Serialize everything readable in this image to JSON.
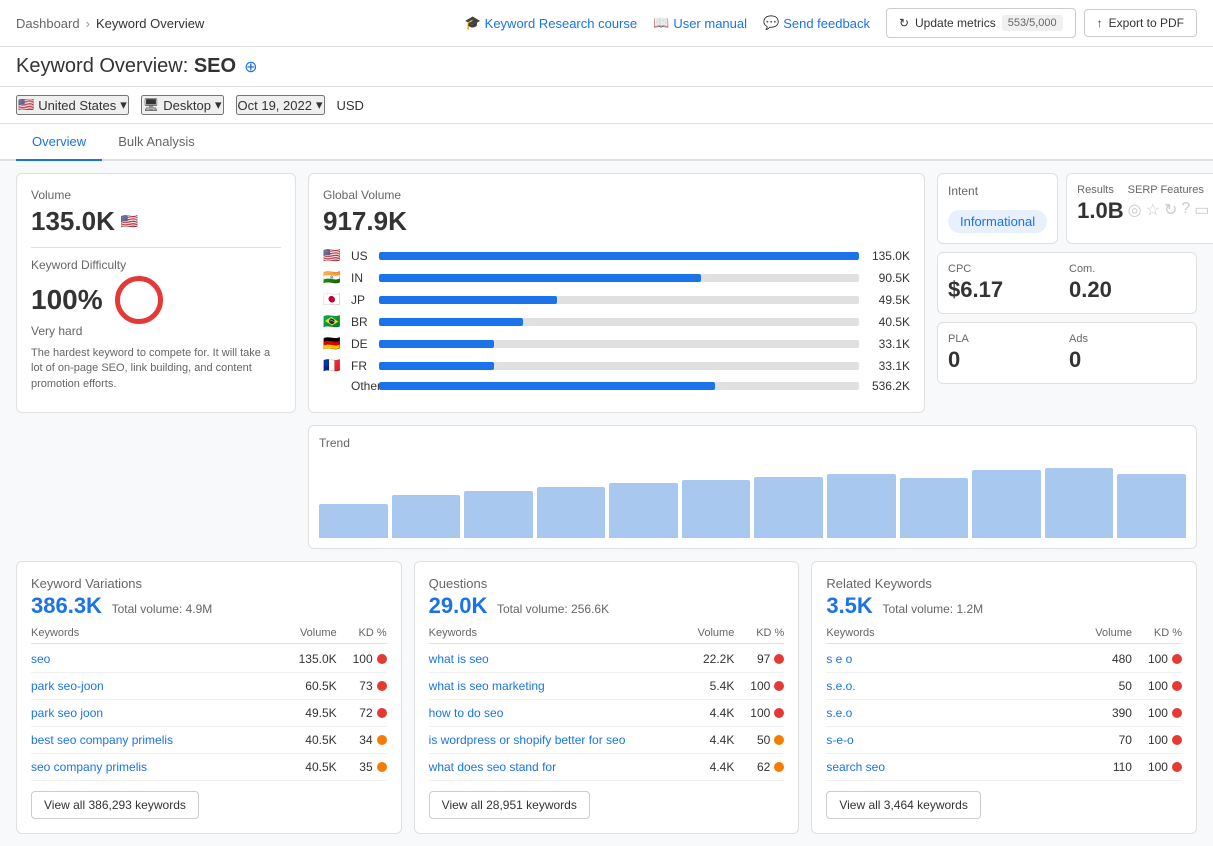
{
  "breadcrumb": {
    "parent": "Dashboard",
    "child": "Keyword Overview"
  },
  "topLinks": [
    {
      "label": "Keyword Research course",
      "icon": "graduation-icon"
    },
    {
      "label": "User manual",
      "icon": "book-icon"
    },
    {
      "label": "Send feedback",
      "icon": "feedback-icon"
    }
  ],
  "toolbar": {
    "updateLabel": "Update metrics",
    "countLabel": "553/5,000",
    "exportLabel": "Export to PDF"
  },
  "pageTitle": {
    "prefix": "Keyword Overview:",
    "keyword": "SEO"
  },
  "filters": {
    "country": "United States",
    "device": "Desktop",
    "date": "Oct 19, 2022",
    "currency": "USD"
  },
  "tabs": [
    {
      "label": "Overview",
      "active": true
    },
    {
      "label": "Bulk Analysis",
      "active": false
    }
  ],
  "volumeWidget": {
    "label": "Volume",
    "value": "135.0K",
    "kdLabel": "Keyword Difficulty",
    "kdValue": "100%",
    "kdSeverity": "Very hard",
    "kdDesc": "The hardest keyword to compete for. It will take a lot of on-page SEO, link building, and content promotion efforts."
  },
  "globalVolumeWidget": {
    "label": "Global Volume",
    "value": "917.9K",
    "countries": [
      {
        "flag": "🇺🇸",
        "code": "US",
        "value": "135.0K",
        "pct": 100
      },
      {
        "flag": "🇮🇳",
        "code": "IN",
        "value": "90.5K",
        "pct": 67
      },
      {
        "flag": "🇯🇵",
        "code": "JP",
        "value": "49.5K",
        "pct": 37
      },
      {
        "flag": "🇧🇷",
        "code": "BR",
        "value": "40.5K",
        "pct": 30
      },
      {
        "flag": "🇩🇪",
        "code": "DE",
        "value": "33.1K",
        "pct": 24
      },
      {
        "flag": "🇫🇷",
        "code": "FR",
        "value": "33.1K",
        "pct": 24
      },
      {
        "flag": "",
        "code": "Other",
        "value": "536.2K",
        "pct": 70
      }
    ]
  },
  "intentWidget": {
    "label": "Intent",
    "badge": "Informational"
  },
  "resultsWidget": {
    "label": "Results",
    "value": "1.0B",
    "serpLabel": "SERP Features"
  },
  "cpcWidget": {
    "cpcLabel": "CPC",
    "cpcValue": "$6.17",
    "comLabel": "Com.",
    "comValue": "0.20"
  },
  "plaAdsWidget": {
    "plaLabel": "PLA",
    "plaValue": "0",
    "adsLabel": "Ads",
    "adsValue": "0"
  },
  "trendWidget": {
    "label": "Trend",
    "bars": [
      40,
      50,
      55,
      60,
      65,
      68,
      72,
      75,
      70,
      80,
      82,
      75
    ]
  },
  "keywordVariations": {
    "sectionLabel": "Keyword Variations",
    "count": "386.3K",
    "totalVolumeLabel": "Total volume:",
    "totalVolume": "4.9M",
    "colHeaders": [
      "Keywords",
      "Volume",
      "KD %"
    ],
    "rows": [
      {
        "kw": "seo",
        "vol": "135.0K",
        "kd": "100",
        "dotClass": "dot-red"
      },
      {
        "kw": "park seo-joon",
        "vol": "60.5K",
        "kd": "73",
        "dotClass": "dot-red"
      },
      {
        "kw": "park seo joon",
        "vol": "49.5K",
        "kd": "72",
        "dotClass": "dot-red"
      },
      {
        "kw": "best seo company primelis",
        "vol": "40.5K",
        "kd": "34",
        "dotClass": "dot-orange"
      },
      {
        "kw": "seo company primelis",
        "vol": "40.5K",
        "kd": "35",
        "dotClass": "dot-orange"
      }
    ],
    "viewAllLabel": "View all 386,293 keywords"
  },
  "questions": {
    "sectionLabel": "Questions",
    "count": "29.0K",
    "totalVolumeLabel": "Total volume:",
    "totalVolume": "256.6K",
    "colHeaders": [
      "Keywords",
      "Volume",
      "KD %"
    ],
    "rows": [
      {
        "kw": "what is seo",
        "vol": "22.2K",
        "kd": "97",
        "dotClass": "dot-red"
      },
      {
        "kw": "what is seo marketing",
        "vol": "5.4K",
        "kd": "100",
        "dotClass": "dot-red"
      },
      {
        "kw": "how to do seo",
        "vol": "4.4K",
        "kd": "100",
        "dotClass": "dot-red"
      },
      {
        "kw": "is wordpress or shopify better for seo",
        "vol": "4.4K",
        "kd": "50",
        "dotClass": "dot-orange"
      },
      {
        "kw": "what does seo stand for",
        "vol": "4.4K",
        "kd": "62",
        "dotClass": "dot-orange"
      }
    ],
    "viewAllLabel": "View all 28,951 keywords"
  },
  "relatedKeywords": {
    "sectionLabel": "Related Keywords",
    "count": "3.5K",
    "totalVolumeLabel": "Total volume:",
    "totalVolume": "1.2M",
    "colHeaders": [
      "Keywords",
      "Volume",
      "KD %"
    ],
    "rows": [
      {
        "kw": "s e o",
        "vol": "480",
        "kd": "100",
        "dotClass": "dot-red"
      },
      {
        "kw": "s.e.o.",
        "vol": "50",
        "kd": "100",
        "dotClass": "dot-red"
      },
      {
        "kw": "s.e.o",
        "vol": "390",
        "kd": "100",
        "dotClass": "dot-red"
      },
      {
        "kw": "s-e-o",
        "vol": "70",
        "kd": "100",
        "dotClass": "dot-red"
      },
      {
        "kw": "search seo",
        "vol": "110",
        "kd": "100",
        "dotClass": "dot-red"
      }
    ],
    "viewAllLabel": "View all 3,464 keywords"
  }
}
